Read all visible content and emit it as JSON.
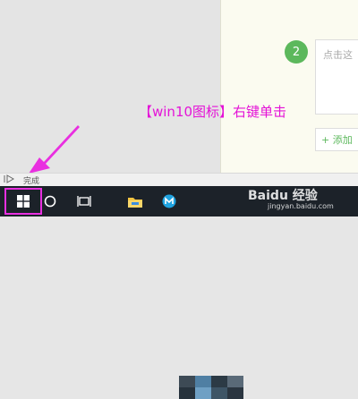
{
  "right_panel": {
    "step_number": "2",
    "input_placeholder": "点击这",
    "add_label": "+ 添加"
  },
  "annotation": {
    "caption": "【win10图标】右键单击",
    "color": "#e413d7"
  },
  "status_bar": {
    "text": "完成"
  },
  "taskbar": {
    "items": [
      "start-windows-icon",
      "cortana-search-icon",
      "task-view-icon",
      "file-explorer-icon",
      "app-icon"
    ]
  },
  "watermark": {
    "brand": "Baidu 经验",
    "url": "jingyan.baidu.com"
  }
}
